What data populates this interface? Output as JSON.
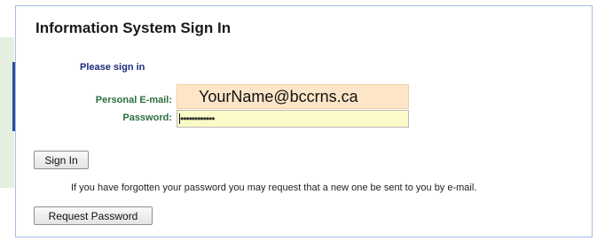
{
  "signin": {
    "title": "Information System Sign In",
    "subtitle": "Please sign in",
    "email_label": "Personal E-mail:",
    "email_value": "YourName@bccrns.ca",
    "password_label": "Password:",
    "password_value": "••••••••••••",
    "signin_button": "Sign In",
    "forgot_text": "If you have forgotten your password you may request that a new one be sent to you by e-mail.",
    "request_button": "Request Password"
  },
  "colors": {
    "panel_border": "#a6bde6",
    "email_field_bg": "#fde6c8",
    "password_field_bg": "#fbfbc9",
    "label_green": "#2c6e3f",
    "subtitle_navy": "#1f2b7a",
    "accent_blue": "#2b4e9c",
    "side_green": "#e4efdf"
  }
}
